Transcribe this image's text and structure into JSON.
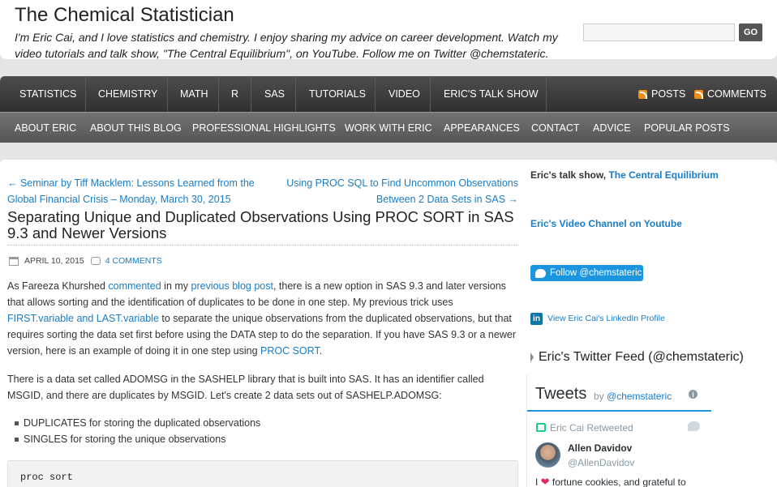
{
  "header": {
    "title": "The Chemical Statistician",
    "description": "I'm Eric Cai, and I love statistics and chemistry. I enjoy sharing my advice on career development. Watch my video tutorials and talk show, \"The Central Equilibrium\", on YouTube. Follow me on Twitter @chemstateric.",
    "search_placeholder": "",
    "search_button": "GO"
  },
  "nav_primary": [
    "STATISTICS",
    "CHEMISTRY",
    "MATH",
    "R",
    "SAS",
    "TUTORIALS",
    "VIDEO",
    "ERIC'S TALK SHOW"
  ],
  "nav_feeds": {
    "posts": "POSTS",
    "comments": "COMMENTS"
  },
  "nav_secondary": [
    "ABOUT ERIC",
    "ABOUT THIS BLOG",
    "PROFESSIONAL HIGHLIGHTS",
    "WORK WITH ERIC",
    "APPEARANCES",
    "CONTACT",
    "ADVICE",
    "POPULAR POSTS"
  ],
  "post_nav": {
    "prev_line1": "← Seminar by Tiff Macklem: Lessons Learned from the",
    "prev_line2": "Global Financial Crisis – Monday, March 30, 2015",
    "next_line1": "Using PROC SQL to Find Uncommon Observations",
    "next_line2": "Between 2 Data Sets in SAS →"
  },
  "post": {
    "title": "Separating Unique and Duplicated Observations Using PROC SORT in SAS 9.3 and Newer Versions",
    "date": "APRIL 10, 2015",
    "comments": "4 COMMENTS",
    "p1": {
      "t1": "As Fareeza Khurshed ",
      "l1": "commented",
      "t2": " in my ",
      "l2": "previous blog post",
      "t3": ", there is a new option in SAS 9.3 and later versions that allows sorting and the identification of duplicates to be done in one step.  My previous trick uses ",
      "l3": "FIRST.variable and LAST.variable",
      "t4": " to separate the unique observations from the duplicated observations, but that requires sorting the data set first before using the DATA step to do the separation.  If you have SAS 9.3 or a newer version, here is an example of doing it in one step using ",
      "l4": "PROC SORT",
      "t5": "."
    },
    "p2": "There is a data set called ADOMSG in the SASHELP library that is built into SAS.  It has an identifier called MSGID, and there are duplicates by MSGID.  Let's create 2 data sets out of SASHELP.ADOMSG:",
    "list": [
      "DUPLICATES for storing the duplicated observations",
      "SINGLES for storing the unique observations"
    ],
    "code": "proc sort"
  },
  "sidebar": {
    "talk_prefix": "Eric's talk show, ",
    "talk_link": "The Central Equilibrium",
    "video_channel": "Eric's Video Channel on Youtube",
    "follow_button": "Follow @chemstateric",
    "linkedin_icon": "in",
    "linkedin": "View Eric Cai's LinkedIn Profile",
    "feed_title": "Eric's Twitter Feed (@chemstateric)",
    "tweets": {
      "title": "Tweets",
      "by": "by ",
      "handle": "@chemstateric",
      "info_icon": "i",
      "retweeted": "Eric Cai Retweeted",
      "author_name": "Allen Davidov",
      "author_handle": "@AllenDavidov",
      "text_pre": "I ",
      "text_post": " fortune cookies, and grateful to"
    }
  },
  "colors": {
    "link": "#1a7cc7",
    "nav_dark": "#3a3a3a",
    "nav_light": "#636363",
    "twitter": "#1b95e0"
  }
}
